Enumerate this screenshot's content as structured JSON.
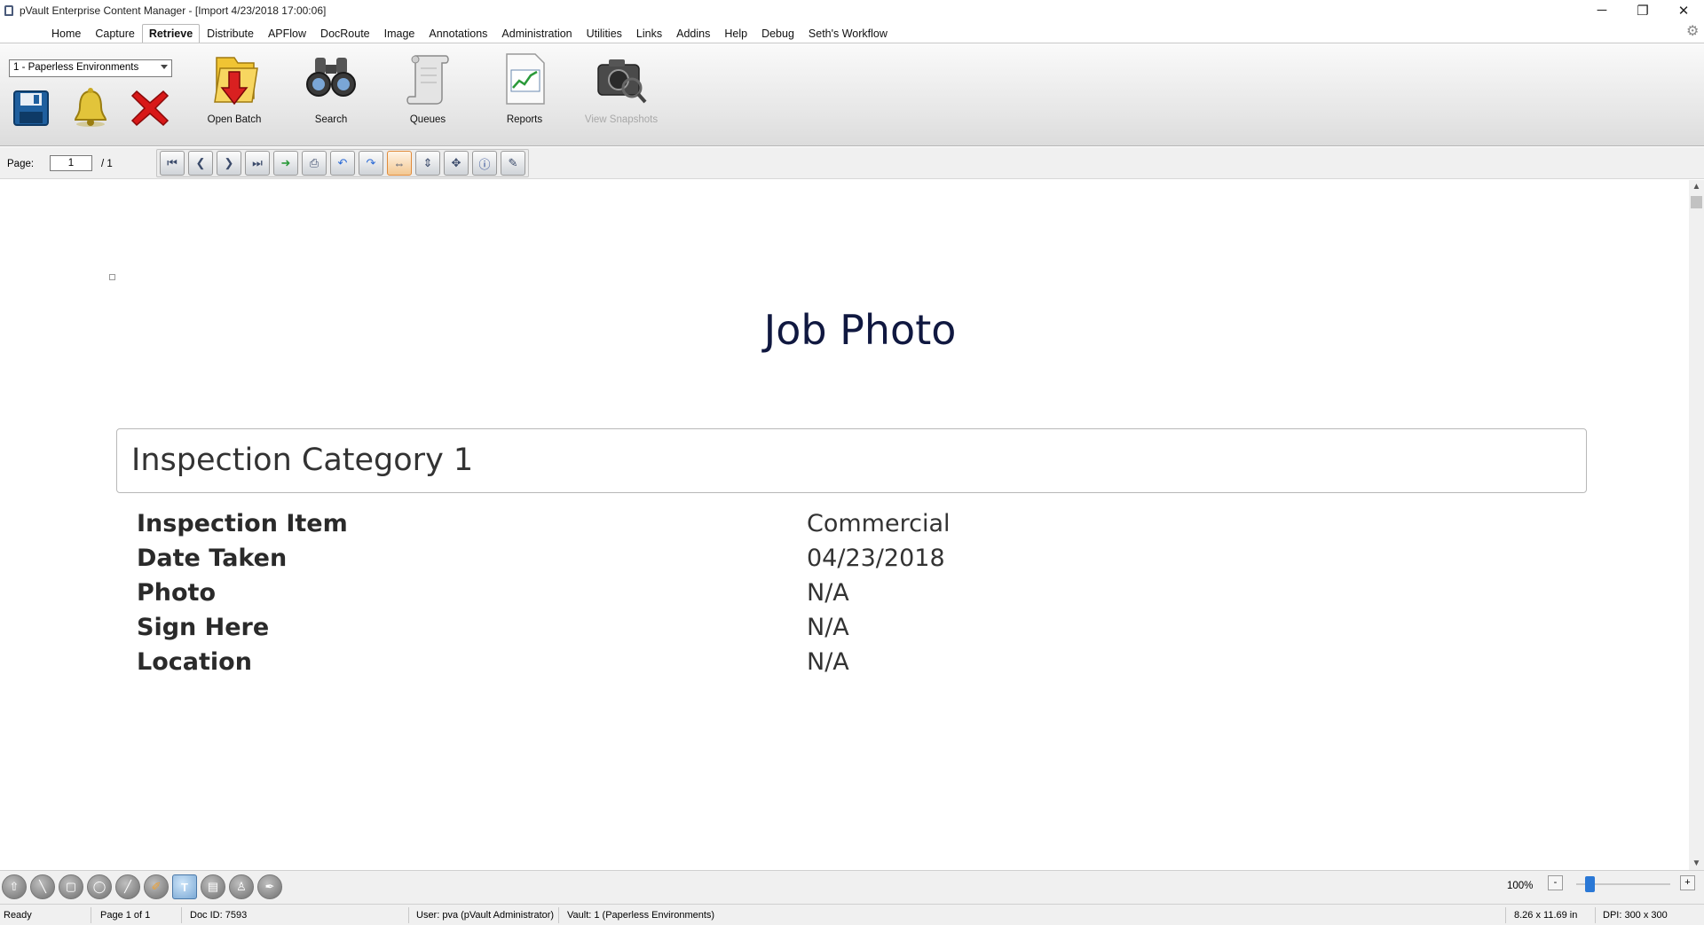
{
  "window": {
    "title": "pVault Enterprise Content Manager - [Import 4/23/2018 17:00:06]",
    "minimize_glyph": "─",
    "restore_glyph": "❐",
    "close_glyph": "✕"
  },
  "menu": {
    "items": [
      "Home",
      "Capture",
      "Retrieve",
      "Distribute",
      "APFlow",
      "DocRoute",
      "Image",
      "Annotations",
      "Administration",
      "Utilities",
      "Links",
      "Addins",
      "Help",
      "Debug",
      "Seth's Workflow"
    ],
    "active": "Retrieve"
  },
  "ribbon": {
    "vault_selected": "1 - Paperless Environments",
    "open_batch_label": "Open Batch",
    "search_label": "Search",
    "queues_label": "Queues",
    "reports_label": "Reports",
    "view_snapshots_label": "View Snapshots",
    "icons": [
      "save-icon",
      "bell-icon",
      "delete-icon",
      "open-batch-folder-icon",
      "binoculars-icon",
      "scroll-icon",
      "reports-chart-icon",
      "camera-magnifier-icon"
    ]
  },
  "pagebar": {
    "page_label": "Page:",
    "page_value": "1",
    "page_total": "/ 1",
    "nav_icons": [
      "first-page-icon",
      "prev-page-icon",
      "next-page-icon",
      "last-page-icon",
      "send-icon",
      "print-icon",
      "rotate-left-icon",
      "rotate-right-icon",
      "fit-width-icon",
      "fit-height-icon",
      "fit-page-icon",
      "info-icon",
      "notes-icon"
    ]
  },
  "document": {
    "title": "Job Photo",
    "category": "Inspection Category 1",
    "fields": [
      {
        "label": "Inspection Item",
        "value": "Commercial"
      },
      {
        "label": "Date Taken",
        "value": "04/23/2018"
      },
      {
        "label": "Photo",
        "value": "N/A"
      },
      {
        "label": "Sign Here",
        "value": "N/A"
      },
      {
        "label": "Location",
        "value": "N/A"
      }
    ]
  },
  "annotation_tools": [
    "pointer-icon",
    "line-icon",
    "rectangle-icon",
    "ellipse-icon",
    "arrow-icon",
    "highlighter-icon",
    "text-icon",
    "note-icon",
    "stamp-icon",
    "pen-icon"
  ],
  "zoom": {
    "label": "100%",
    "minus": "-",
    "plus": "+",
    "level_fraction": 0.15
  },
  "status": {
    "state": "Ready",
    "page": "Page 1 of 1",
    "doc_id": "Doc ID: 7593",
    "user": "User: pva (pVault Administrator)",
    "vault": "Vault: 1 (Paperless Environments)",
    "size": "8.26 x 11.69 in",
    "dpi": "DPI: 300 x 300"
  },
  "colors": {
    "doc_title": "#101840",
    "zoom_thumb": "#2a78d6",
    "delete_red": "#d81818",
    "selected_nav": "#e08a3a"
  }
}
